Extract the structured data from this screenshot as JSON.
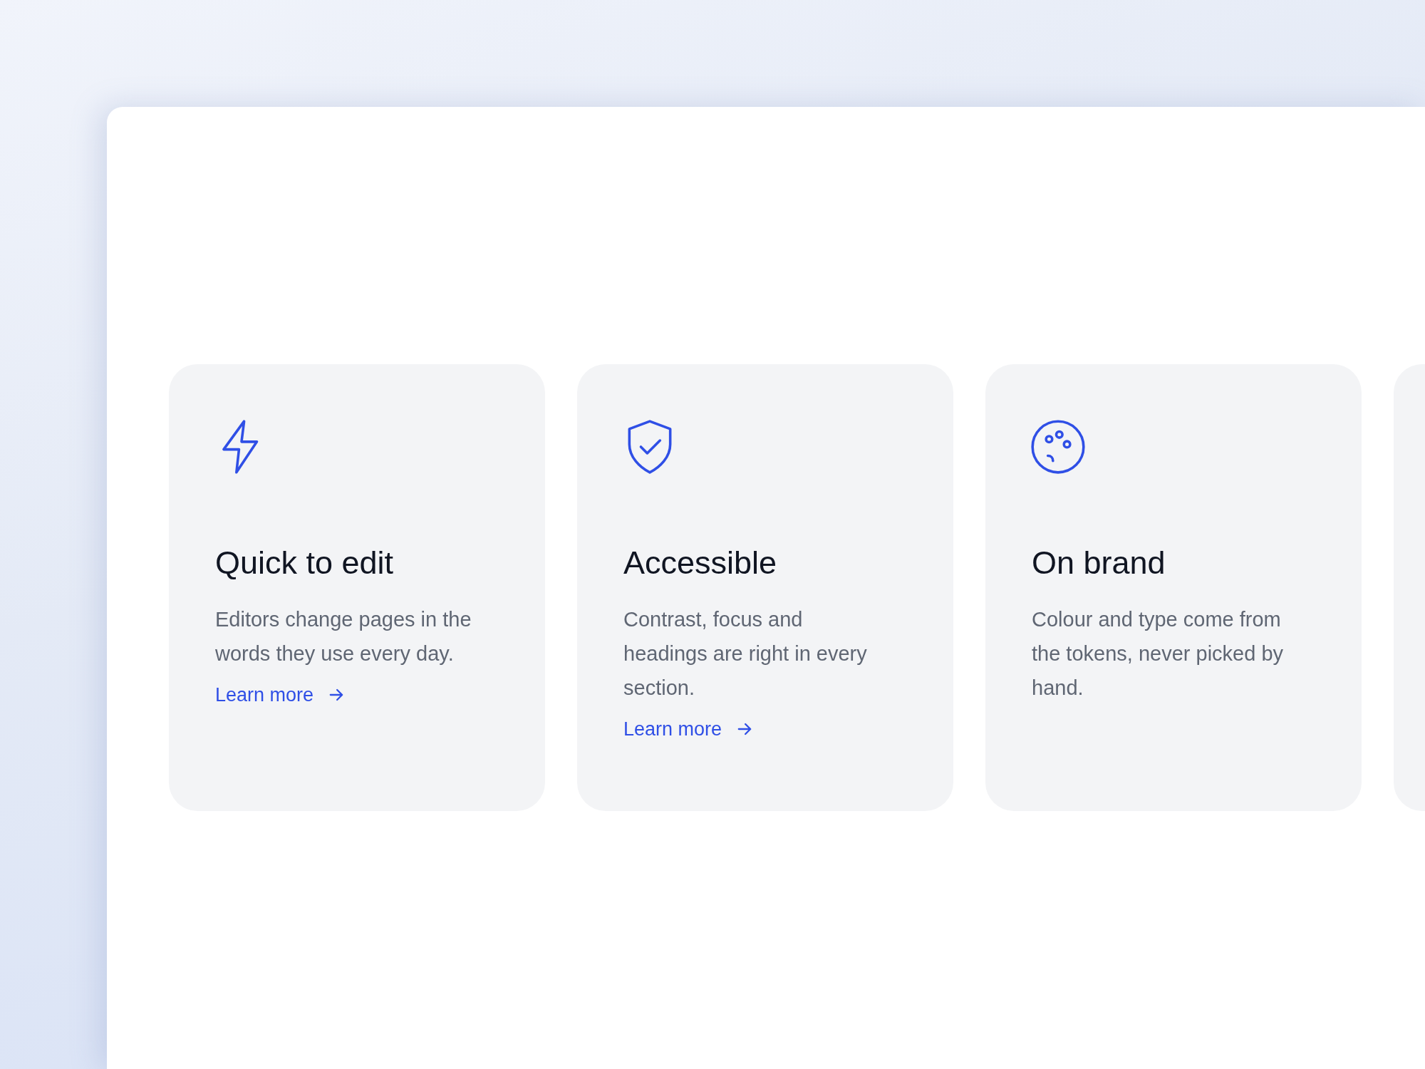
{
  "cards": [
    {
      "title": "Quick to edit",
      "text": "Editors change pages in the words they use every day.",
      "link": "Learn more"
    },
    {
      "title": "Accessible",
      "text": "Contrast, focus and headings are right in every section.",
      "link": "Learn more"
    },
    {
      "title": "On brand",
      "text": "Colour and type come from the tokens, never picked by hand."
    }
  ]
}
